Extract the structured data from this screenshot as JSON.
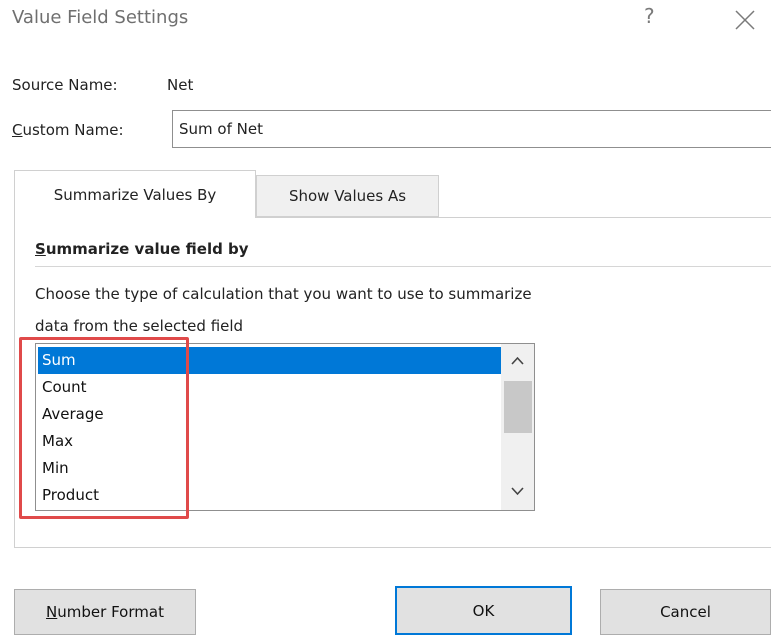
{
  "dialog": {
    "title": "Value Field Settings",
    "help": "?",
    "close_icon": "close-icon"
  },
  "source": {
    "label": "Source Name:",
    "value": "Net"
  },
  "custom_name": {
    "label_first": "C",
    "label_rest": "ustom Name:",
    "value": "Sum of Net"
  },
  "tabs": [
    {
      "label": "Summarize Values By",
      "active": true
    },
    {
      "label": "Show Values As",
      "active": false
    }
  ],
  "summarize": {
    "heading_first": "S",
    "heading_rest": "ummarize value field by",
    "description_line1": "Choose the type of calculation that you want to use to summarize",
    "description_line2": "data from the selected field",
    "options": [
      "Sum",
      "Count",
      "Average",
      "Max",
      "Min",
      "Product"
    ],
    "selected": "Sum"
  },
  "buttons": {
    "number_format_first": "N",
    "number_format_rest": "umber Format",
    "ok": "OK",
    "cancel": "Cancel"
  },
  "colors": {
    "selection": "#0078d7",
    "highlight_box": "#e04a4a",
    "ok_border": "#0078d7"
  },
  "icons": {
    "scroll_up": "chevron-up-icon",
    "scroll_down": "chevron-down-icon"
  }
}
